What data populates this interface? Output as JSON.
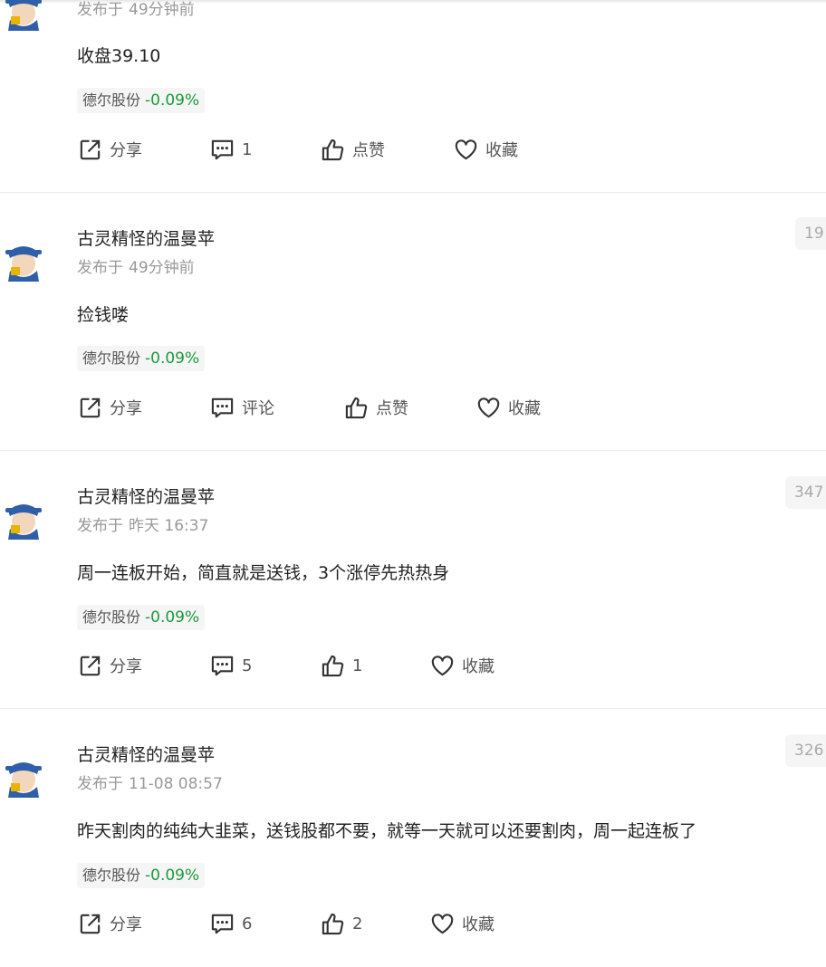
{
  "labels": {
    "publish_prefix": "发布于",
    "share": "分享",
    "comment": "评论",
    "like": "点赞",
    "favorite": "收藏"
  },
  "posts": [
    {
      "author": "",
      "time": "49分钟前",
      "content": "收盘39.10",
      "stock": {
        "name": "德尔股份",
        "change": "-0.09%"
      },
      "views": "",
      "comment_label": "1",
      "like_label": "点赞"
    },
    {
      "author": "古灵精怪的温曼苹",
      "time": "49分钟前",
      "content": "捡钱喽",
      "stock": {
        "name": "德尔股份",
        "change": "-0.09%"
      },
      "views": "19",
      "comment_label": "评论",
      "like_label": "点赞"
    },
    {
      "author": "古灵精怪的温曼苹",
      "time": "昨天 16:37",
      "content": "周一连板开始，简直就是送钱，3个涨停先热热身",
      "stock": {
        "name": "德尔股份",
        "change": "-0.09%"
      },
      "views": "347",
      "comment_label": "5",
      "like_label": "1"
    },
    {
      "author": "古灵精怪的温曼苹",
      "time": "11-08 08:57",
      "content": "昨天割肉的纯纯大韭菜，送钱股都不要，就等一天就可以还要割肉，周一起连板了",
      "stock": {
        "name": "德尔股份",
        "change": "-0.09%"
      },
      "views": "326",
      "comment_label": "6",
      "like_label": "2"
    }
  ],
  "colors": {
    "stock_change_negative": "#1a9a3a",
    "meta_gray": "#999999",
    "text": "#222222",
    "divider": "#ececec"
  },
  "icons": {
    "avatar": "cartoon-official-avatar",
    "share": "share-icon",
    "comment": "comment-icon",
    "like": "thumbs-up-icon",
    "favorite": "heart-icon"
  }
}
